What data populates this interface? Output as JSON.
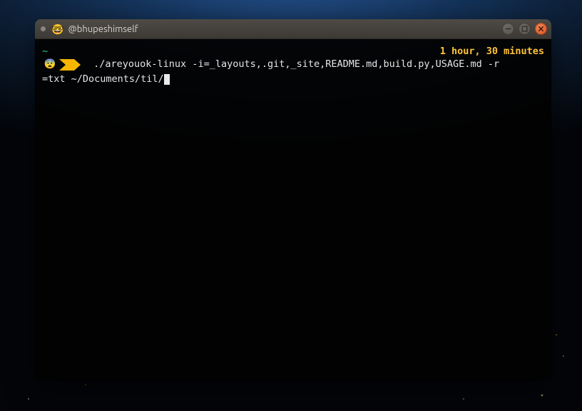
{
  "window": {
    "title": "@bhupeshimself",
    "title_emoji": "🤓",
    "controls": {
      "minimize": "minimize",
      "maximize": "maximize",
      "close": "close"
    }
  },
  "terminal": {
    "cwd_indicator": "~",
    "uptime": "1 hour, 30 minutes",
    "prompt_emoji": "😨",
    "command_line1": " ./areyouok-linux -i=_layouts,.git,_site,README.md,build.py,USAGE.md -r",
    "command_line2": "=txt ~/Documents/til/"
  },
  "colors": {
    "accent_green": "#22d37a",
    "accent_yellow": "#ffc33a",
    "close_btn": "#dd5322"
  }
}
